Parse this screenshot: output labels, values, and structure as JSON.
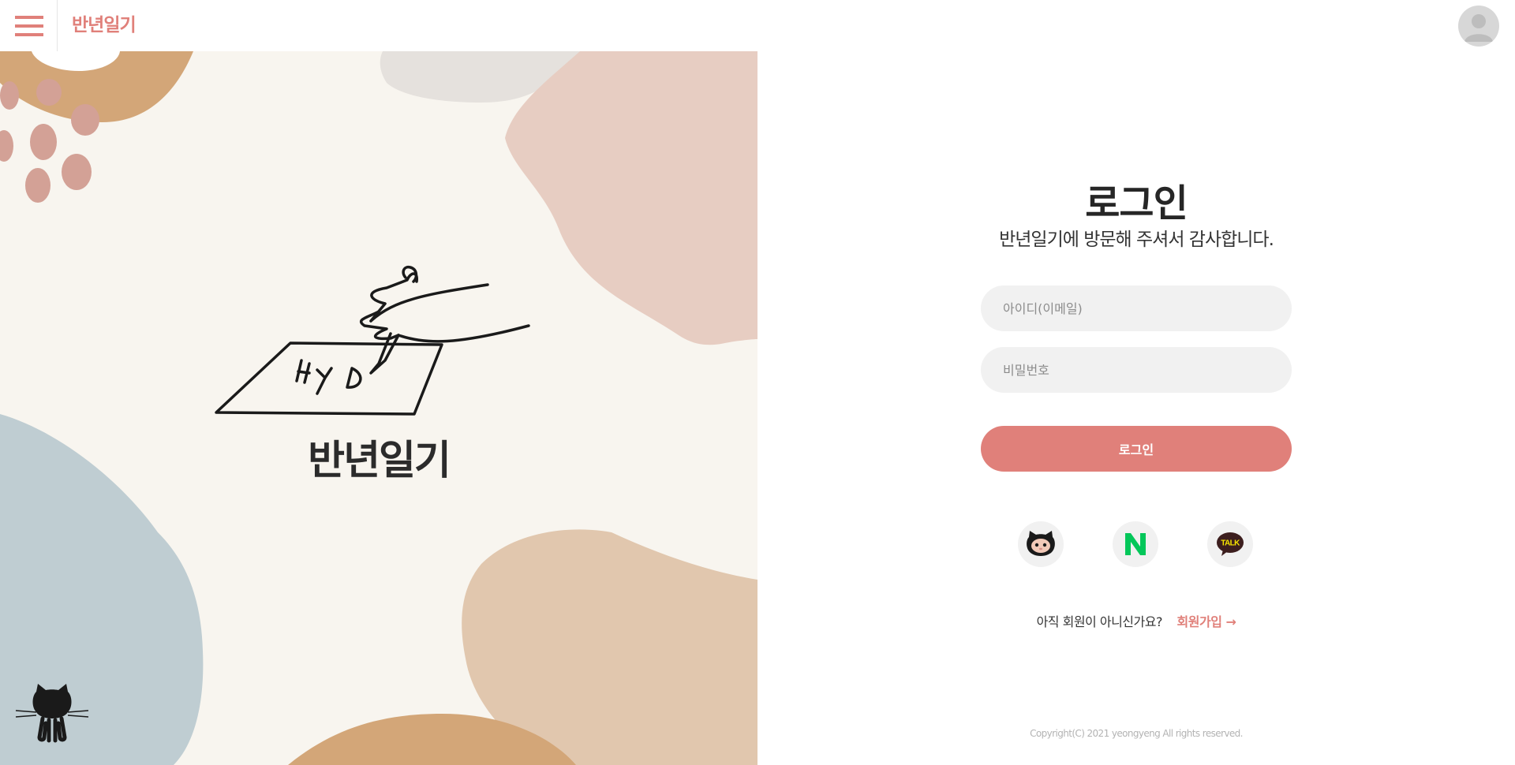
{
  "header": {
    "brand": "반년일기",
    "menu_icon": "hamburger-menu-icon",
    "profile_icon": "user-avatar-icon"
  },
  "hero": {
    "title": "반년일기",
    "illustration_text": "HYD",
    "github_icon": "github-octocat-icon"
  },
  "login": {
    "title": "로그인",
    "subtitle": "반년일기에 방문해 주셔서 감사합니다.",
    "id_placeholder": "아이디(이메일)",
    "password_placeholder": "비밀번호",
    "submit_label": "로그인",
    "social": [
      {
        "name": "github",
        "icon": "github-icon"
      },
      {
        "name": "naver",
        "icon": "naver-icon",
        "glyph": "N"
      },
      {
        "name": "kakao",
        "icon": "kakao-talk-icon",
        "glyph": "TALK"
      }
    ],
    "signup_prompt": "아직 회원이 아니신가요?",
    "signup_link": "회원가입 →"
  },
  "footer": {
    "copyright": "Copyright(C) 2021 yeongyeng All rights reserved."
  },
  "colors": {
    "accent": "#e0807a",
    "input_bg": "#f1f1f1",
    "art_bg": "#f8f5ef",
    "blob_orange": "#d3a678",
    "blob_pink": "#e7cdc2",
    "blob_tan": "#e1c7ae",
    "blob_blue": "#bfcdd2",
    "blob_grey": "#e5e1dd",
    "dot_color": "#d3a196"
  }
}
